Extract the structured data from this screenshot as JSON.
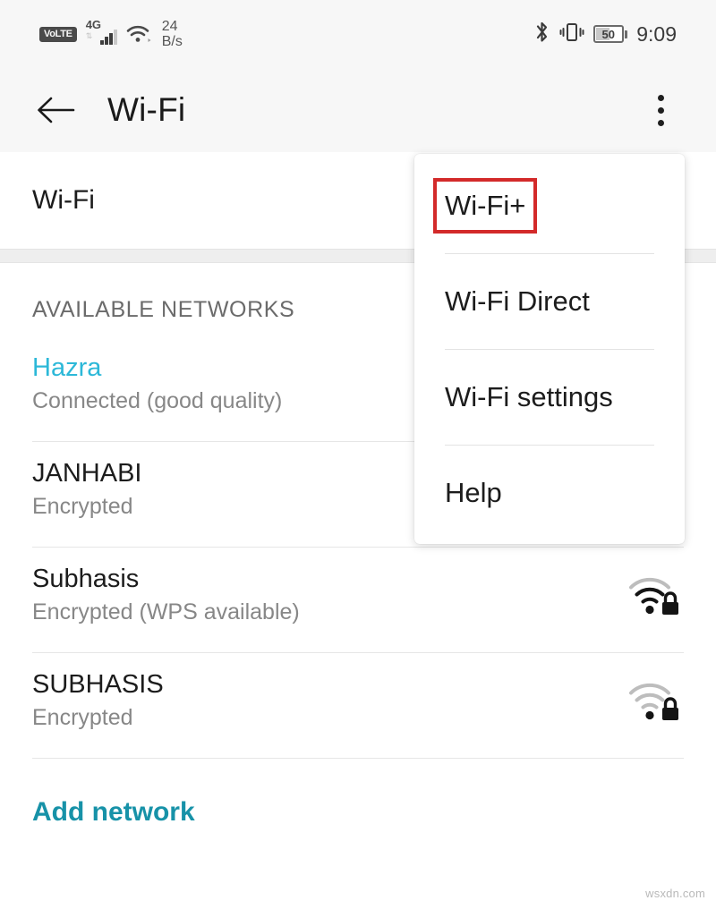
{
  "statusbar": {
    "volte": "VoLTE",
    "network_type": "4G",
    "data_rate_value": "24",
    "data_rate_unit": "B/s",
    "battery_level": "50",
    "time": "9:09",
    "icons": [
      "volte-badge",
      "signal-bars-icon",
      "wifi-icon",
      "bluetooth-icon",
      "vibrate-icon",
      "battery-icon"
    ]
  },
  "appbar": {
    "back_icon": "back-arrow-icon",
    "title": "Wi-Fi",
    "overflow_icon": "overflow-menu-icon"
  },
  "main": {
    "wifi_toggle_label": "Wi-Fi",
    "section_header": "AVAILABLE NETWORKS",
    "networks": [
      {
        "name": "Hazra",
        "status": "Connected (good quality)",
        "connected": true,
        "icon": ""
      },
      {
        "name": "JANHABI",
        "status": "Encrypted",
        "connected": false,
        "icon": ""
      },
      {
        "name": "Subhasis",
        "status": "Encrypted (WPS available)",
        "connected": false,
        "icon": "wifi-lock-strong-icon"
      },
      {
        "name": "SUBHASIS",
        "status": "Encrypted",
        "connected": false,
        "icon": "wifi-lock-weak-icon"
      }
    ],
    "add_network_label": "Add network"
  },
  "menu": {
    "items": [
      {
        "label": "Wi-Fi+",
        "highlighted": true
      },
      {
        "label": "Wi-Fi Direct",
        "highlighted": false
      },
      {
        "label": "Wi-Fi settings",
        "highlighted": false
      },
      {
        "label": "Help",
        "highlighted": false
      }
    ]
  },
  "watermark": "wsxdn.com",
  "colors": {
    "connected_network": "#2cb8d8",
    "add_network_link": "#1792a8",
    "highlight_box": "#d32a2a",
    "status_bar_bg": "#f7f7f7"
  }
}
